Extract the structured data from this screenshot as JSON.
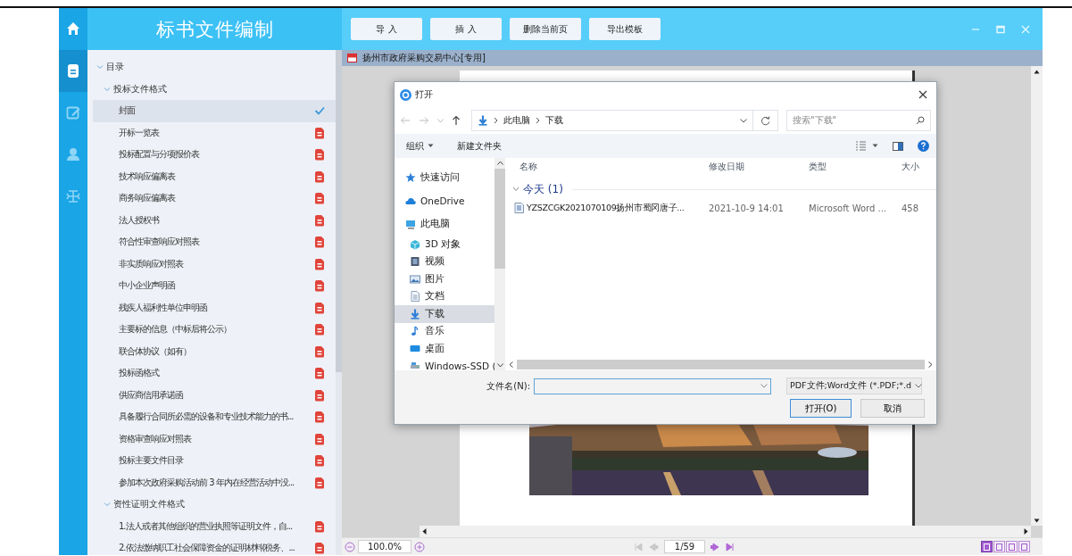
{
  "rail": {
    "items": [
      {
        "selected": false
      },
      {
        "selected": true
      },
      {
        "selected": false
      },
      {
        "selected": false
      },
      {
        "selected": false
      }
    ]
  },
  "sidebar": {
    "title": "标书文件编制",
    "tree": [
      {
        "label": "目录",
        "expanded": true,
        "children": [
          {
            "label": "投标文件格式",
            "expanded": true,
            "children": [
              {
                "label": "封面",
                "selected": true,
                "done": true
              },
              {
                "label": "开标一览表",
                "selected": false,
                "done": false
              },
              {
                "label": "投标配置与分项报价表",
                "selected": false,
                "done": false
              },
              {
                "label": "技术响应偏离表",
                "selected": false,
                "done": false
              },
              {
                "label": "商务响应偏离表",
                "selected": false,
                "done": false
              },
              {
                "label": "法人授权书",
                "selected": false,
                "done": false
              },
              {
                "label": "符合性审查响应对照表",
                "selected": false,
                "done": false
              },
              {
                "label": "非实质响应对照表",
                "selected": false,
                "done": false
              },
              {
                "label": "中小企业声明函",
                "selected": false,
                "done": false
              },
              {
                "label": "残疾人福利性单位申明函",
                "selected": false,
                "done": false
              },
              {
                "label": "主要标的信息（中标后将公示）",
                "selected": false,
                "done": false
              },
              {
                "label": "联合体协议（如有）",
                "selected": false,
                "done": false
              },
              {
                "label": "投标函格式",
                "selected": false,
                "done": false
              },
              {
                "label": "供应商信用承诺函",
                "selected": false,
                "done": false
              },
              {
                "label": "具备履行合同所必需的设备和专业技术能力的书...",
                "selected": false,
                "done": false
              },
              {
                "label": "资格审查响应对照表",
                "selected": false,
                "done": false
              },
              {
                "label": "投标主要文件目录",
                "selected": false,
                "done": false
              },
              {
                "label": "参加本次政府采购活动前 3 年内在经营活动中没...",
                "selected": false,
                "done": false
              }
            ]
          },
          {
            "label": "资性证明文件格式",
            "expanded": true,
            "children": [
              {
                "label": "1.法人或者其他组织的营业执照等证明文件，自...",
                "selected": false,
                "done": false
              },
              {
                "label": "2.依法缴纳职工社会保障资金的证明材料(税务、...",
                "selected": false,
                "done": false
              }
            ]
          }
        ]
      }
    ]
  },
  "toolbar": {
    "buttons": [
      "导 入",
      "插 入",
      "删除当前页",
      "导出模板"
    ]
  },
  "document": {
    "title": "扬州市政府采购交易中心[专用]"
  },
  "dialog": {
    "title": "打开",
    "path": [
      "此电脑",
      "下载"
    ],
    "search_placeholder": "搜索\"下载\"",
    "organize": "组织",
    "new_folder": "新建文件夹",
    "nav_pane": [
      {
        "label": "快速访问",
        "selected": false
      },
      {
        "label": "OneDrive",
        "selected": false
      },
      {
        "label": "此电脑",
        "selected": false,
        "children": [
          {
            "label": "3D 对象",
            "selected": false
          },
          {
            "label": "视频",
            "selected": false
          },
          {
            "label": "图片",
            "selected": false
          },
          {
            "label": "文档",
            "selected": false
          },
          {
            "label": "下载",
            "selected": true
          },
          {
            "label": "音乐",
            "selected": false
          },
          {
            "label": "桌面",
            "selected": false
          },
          {
            "label": "Windows-SSD (",
            "selected": false
          }
        ]
      }
    ],
    "columns": [
      "名称",
      "修改日期",
      "类型",
      "大小"
    ],
    "group": "今天 (1)",
    "files": [
      {
        "name": "YZSZCGK2021070109扬州市蜀冈唐子...",
        "date": "2021-10-9 14:01",
        "type": "Microsoft Word ...",
        "size": "458"
      }
    ],
    "filename_label": "文件名(N):",
    "filter": "PDF文件;Word文件 (*.PDF;*.d",
    "buttons": [
      "打开(O)",
      "取消"
    ]
  },
  "status_bar": {
    "zoom": "100.0%",
    "page": "1/59",
    "nav": [
      {
        "disabled": true
      },
      {
        "disabled": true
      },
      {
        "disabled": false
      },
      {
        "disabled": false
      }
    ],
    "view_modes": [
      {
        "selected": true
      },
      {
        "selected": false
      },
      {
        "selected": false
      },
      {
        "selected": false
      }
    ]
  }
}
